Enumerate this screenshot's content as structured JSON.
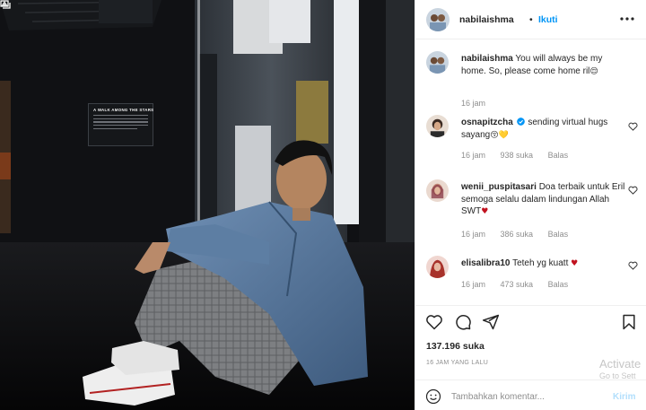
{
  "photo": {
    "plaque_title": "A WALK AMONG THE STARS"
  },
  "post": {
    "username": "nabilaishma",
    "separator": "•",
    "follow_label": "Ikuti",
    "caption_user": "nabilaishma",
    "caption_text": "You will always be my home. So, please come home ril",
    "caption_emoji": "😌",
    "caption_time": "16 jam"
  },
  "comments": [
    {
      "user": "osnapitzcha",
      "verified": true,
      "text": "sending virtual hugs sayang",
      "emoji": "😚💛",
      "time": "16 jam",
      "likes": "938 suka",
      "reply": "Balas"
    },
    {
      "user": "wenii_puspitasari",
      "verified": false,
      "text": "Doa terbaik untuk Eril semoga selalu dalam lindungan Allah SWT",
      "emoji": "♥",
      "time": "16 jam",
      "likes": "386 suka",
      "reply": "Balas"
    },
    {
      "user": "elisalibra10",
      "verified": false,
      "text": "Teteh yg kuatt",
      "emoji": "♥",
      "time": "16 jam",
      "likes": "473 suka",
      "reply": "Balas"
    }
  ],
  "actions": {
    "like_icon": "heart-icon",
    "comment_icon": "comment-icon",
    "share_icon": "share-icon",
    "save_icon": "bookmark-icon"
  },
  "likes_total": "137.196 suka",
  "post_time": "16 JAM YANG LALU",
  "add_comment": {
    "placeholder": "Tambahkan komentar...",
    "send_label": "Kirim",
    "emoji_icon": "smile-icon"
  },
  "watermark": {
    "title": "Activate",
    "subtitle": "Go to Sett"
  },
  "colors": {
    "accent": "#0095f6",
    "send_disabled": "#b2dffc",
    "meta_gray": "#8e8e8e",
    "heart_red": "#c1121f"
  }
}
